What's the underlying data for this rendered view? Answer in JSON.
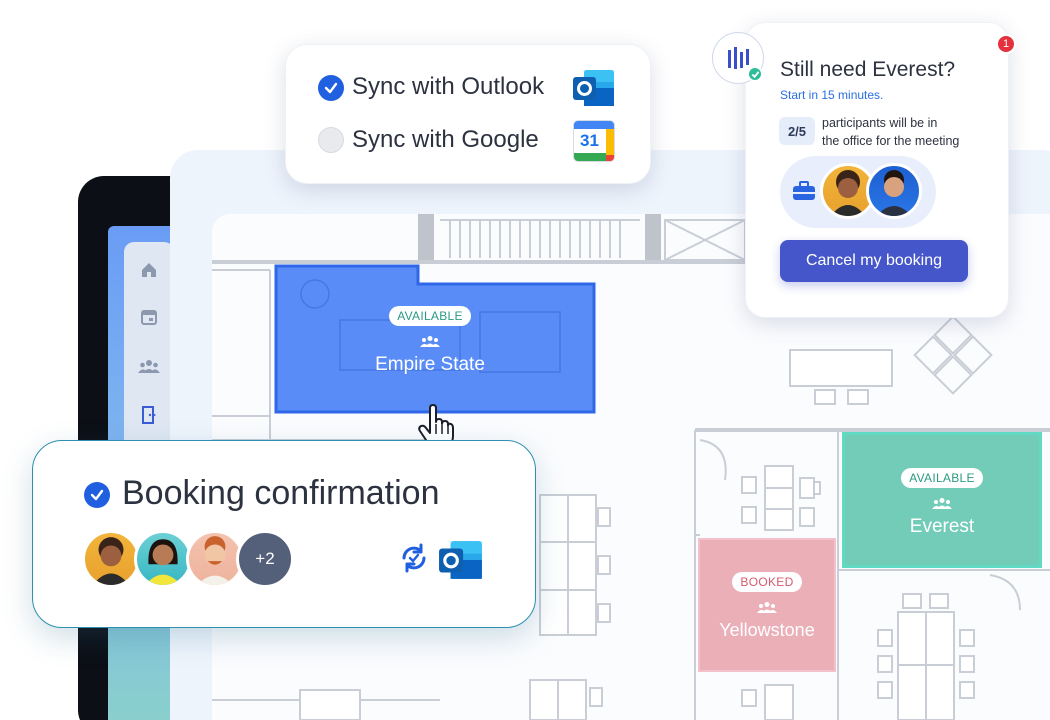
{
  "sync_card": {
    "outlook_label": "Sync with Outlook",
    "google_label": "Sync with Google",
    "calendar_day": "31"
  },
  "reminder_card": {
    "title": "Still need Everest?",
    "subtitle": "Start in 15 minutes.",
    "count": "2/5",
    "participants_text_1": "participants will be in",
    "participants_text_2": "the office for the meeting",
    "cancel_label": "Cancel my booking",
    "notification_count": "1"
  },
  "rooms": {
    "empire": {
      "status": "AVAILABLE",
      "name": "Empire State"
    },
    "everest": {
      "status": "AVAILABLE",
      "name": "Everest"
    },
    "yellowstone": {
      "status": "BOOKED",
      "name": "Yellowstone"
    }
  },
  "booking_card": {
    "title": "Booking confirmation",
    "extra_count": "+2"
  },
  "colors": {
    "accent": "#4456c9",
    "check_blue": "#1f5fe0",
    "available_room": "#4b82f5",
    "everest_room": "#67c9b2",
    "booked_room": "#eaa9b3"
  }
}
